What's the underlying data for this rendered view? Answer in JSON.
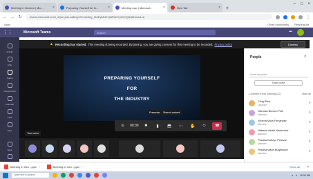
{
  "browser": {
    "tabs": [
      {
        "label": "Meeting in General | Mic..."
      },
      {
        "label": "Preparing Yourself for th..."
      },
      {
        "label": "Meeting now | Microsof..."
      },
      {
        "label": "New Tab"
      }
    ],
    "url": "teams.microsoft.com/_#/pre-join-calling/19:meeting_NmEyMzhlYjItZDk2Yy00YjQ4@thread.v2",
    "bookmarks": {
      "left": "Apps",
      "right": [
        "Other bookmarks",
        "Reading list"
      ]
    }
  },
  "teams": {
    "brand": "Microsoft Teams",
    "search_placeholder": "Search"
  },
  "rail": {
    "items": [
      {
        "label": "Activity"
      },
      {
        "label": "Chat"
      },
      {
        "label": "Teams"
      },
      {
        "label": "Assignments"
      },
      {
        "label": "Calendar"
      },
      {
        "label": "Calls"
      },
      {
        "label": "Files"
      },
      {
        "label": "Apps"
      },
      {
        "label": "Help"
      }
    ]
  },
  "banner": {
    "title": "Recording has started.",
    "text": "This meeting is being recorded. By joining, you are giving consent for this meeting to be recorded.",
    "link": "Privacy policy",
    "dismiss": "Dismiss"
  },
  "shared_screen": {
    "line1": "PREPARING YOURSELF",
    "line2": "FOR",
    "line3": "THE INDUSTRY"
  },
  "labels": {
    "presenter": "Presenter",
    "shared_by": "Shared content",
    "self": "Your name"
  },
  "controls": {
    "timer": "00:00",
    "icons": [
      "timer-icon",
      "camera-icon",
      "mic-icon",
      "share-icon",
      "more-icon",
      "participants-icon",
      "chat-icon",
      "hangup-icon"
    ]
  },
  "participants_panel": {
    "title": "People",
    "search_placeholder": "Invite someone",
    "share_invite": "Share invite",
    "section": "Currently in this meeting (21)",
    "section_action": "Mute all",
    "people": [
      {
        "name": "Cindy Rice",
        "role": "Organizer",
        "color": "#e8b36a"
      },
      {
        "name": "Nicholas Benson Pele",
        "role": "Attendee",
        "color": "#c9a3d8"
      },
      {
        "name": "Ximena Mora Fernandez",
        "role": "Attendee",
        "color": "#9fc6e8"
      },
      {
        "name": "Natasha Ashlie Mackenzie",
        "role": "Attendee",
        "color": "#e89fb4"
      },
      {
        "name": "Priscilla Kathryn Pearson",
        "role": "Attendee",
        "color": "#b3d89f"
      },
      {
        "name": "Priscilla Marie Brayswood",
        "role": "Attendee",
        "color": "#f0c27a"
      }
    ]
  },
  "downloads": {
    "items": [
      {
        "label": "Meeting in Gen...pptx"
      },
      {
        "label": "Meeting in Gen...pptx"
      }
    ],
    "show_all": "Show all"
  },
  "taskbar": {
    "search_placeholder": "Type here to search",
    "time": "10:32 AM"
  },
  "colors": {
    "teams_purple": "#464775",
    "hangup_red": "#c4314b"
  }
}
